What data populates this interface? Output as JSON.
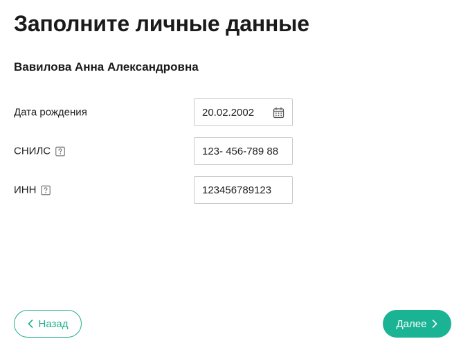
{
  "page": {
    "title": "Заполните личные данные"
  },
  "person": {
    "full_name": "Вавилова Анна Александровна"
  },
  "fields": {
    "birth_date": {
      "label": "Дата рождения",
      "value": "20.02.2002",
      "icon": "calendar-icon"
    },
    "snils": {
      "label": "СНИЛС",
      "value": "123- 456-789 88",
      "icon": "help-icon"
    },
    "inn": {
      "label": "ИНН",
      "value": "123456789123",
      "icon": "help-icon"
    }
  },
  "buttons": {
    "back_label": "Назад",
    "next_label": "Далее",
    "back_icon": "chevron-left-icon",
    "next_icon": "chevron-right-icon"
  },
  "colors": {
    "accent": "#1ab394",
    "accent_border": "#1fae8c",
    "input_border": "#c9c9c9",
    "text": "#1a1a1a"
  }
}
